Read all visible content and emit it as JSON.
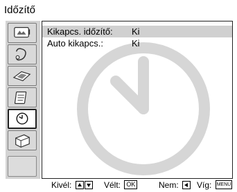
{
  "header": {
    "title": "Időzítő"
  },
  "sidebar": {
    "items": [
      {
        "name": "picture-icon"
      },
      {
        "name": "sound-icon"
      },
      {
        "name": "screen-icon"
      },
      {
        "name": "feature-icon"
      },
      {
        "name": "timer-clock-icon",
        "selected": true
      },
      {
        "name": "setup-icon"
      },
      {
        "name": "empty"
      }
    ]
  },
  "menu": {
    "rows": [
      {
        "label": "Kikapcs. időzítő:",
        "value": "Ki",
        "selected": true
      },
      {
        "label": "Auto kikapcs.:",
        "value": "Ki",
        "selected": false
      }
    ]
  },
  "footer": {
    "select_label": "Kivél:",
    "confirm_label": "Vélt:",
    "confirm_key": "OK",
    "back_label": "Nem:",
    "exit_label": "Víg:",
    "exit_key": "MENU"
  }
}
